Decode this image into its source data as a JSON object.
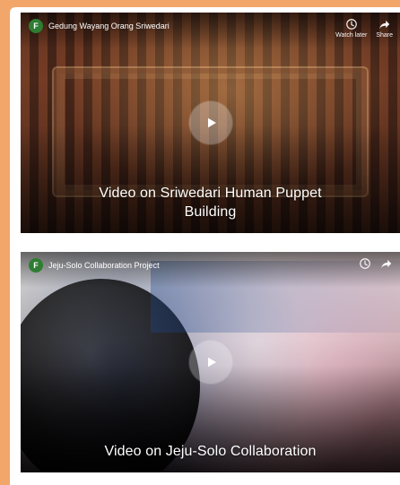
{
  "colors": {
    "background_orange": "#F2A66A",
    "panel_white": "#FFFFFF",
    "caption_text": "#FFFFFF",
    "avatar_green": "#2E7D32"
  },
  "videos": [
    {
      "channel": {
        "avatar_letter": "F",
        "title": "Gedung Wayang Orang Sriwedari"
      },
      "top_actions": {
        "watch_later_label": "Watch later",
        "share_label": "Share"
      },
      "caption": "Video on Sriwedari Human Puppet Building"
    },
    {
      "channel": {
        "avatar_letter": "F",
        "title": "Jeju-Solo Collaboration Project"
      },
      "caption": "Video on Jeju-Solo Collaboration"
    }
  ]
}
